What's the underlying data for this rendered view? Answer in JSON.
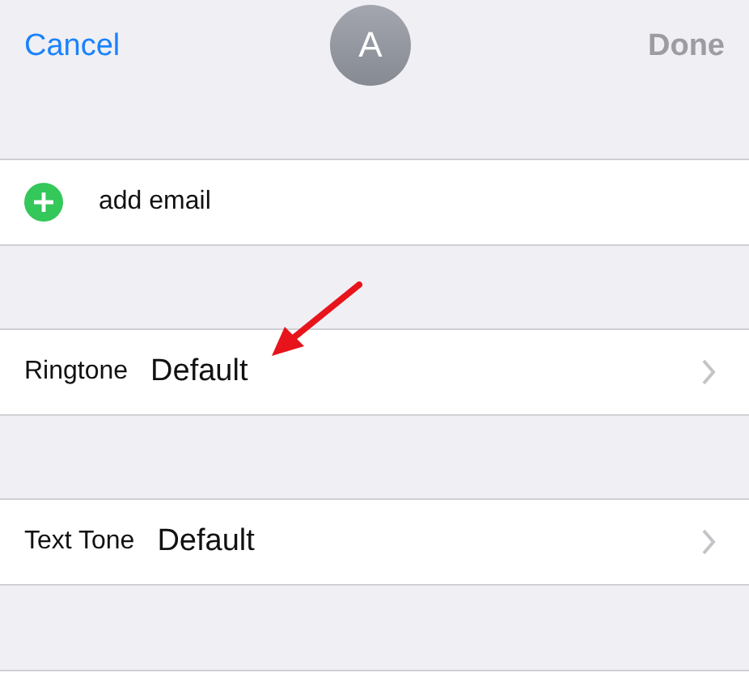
{
  "nav": {
    "cancel": "Cancel",
    "avatar": "A",
    "done": {
      "label": "Done",
      "disabled": true
    }
  },
  "rows": [
    {
      "kind": "add",
      "label": "add email"
    },
    {
      "kind": "setting",
      "label": "Ringtone",
      "value": "Default"
    },
    {
      "kind": "setting",
      "label": "Text Tone",
      "value": "Default"
    }
  ],
  "annotation": {
    "kind": "arrow"
  }
}
